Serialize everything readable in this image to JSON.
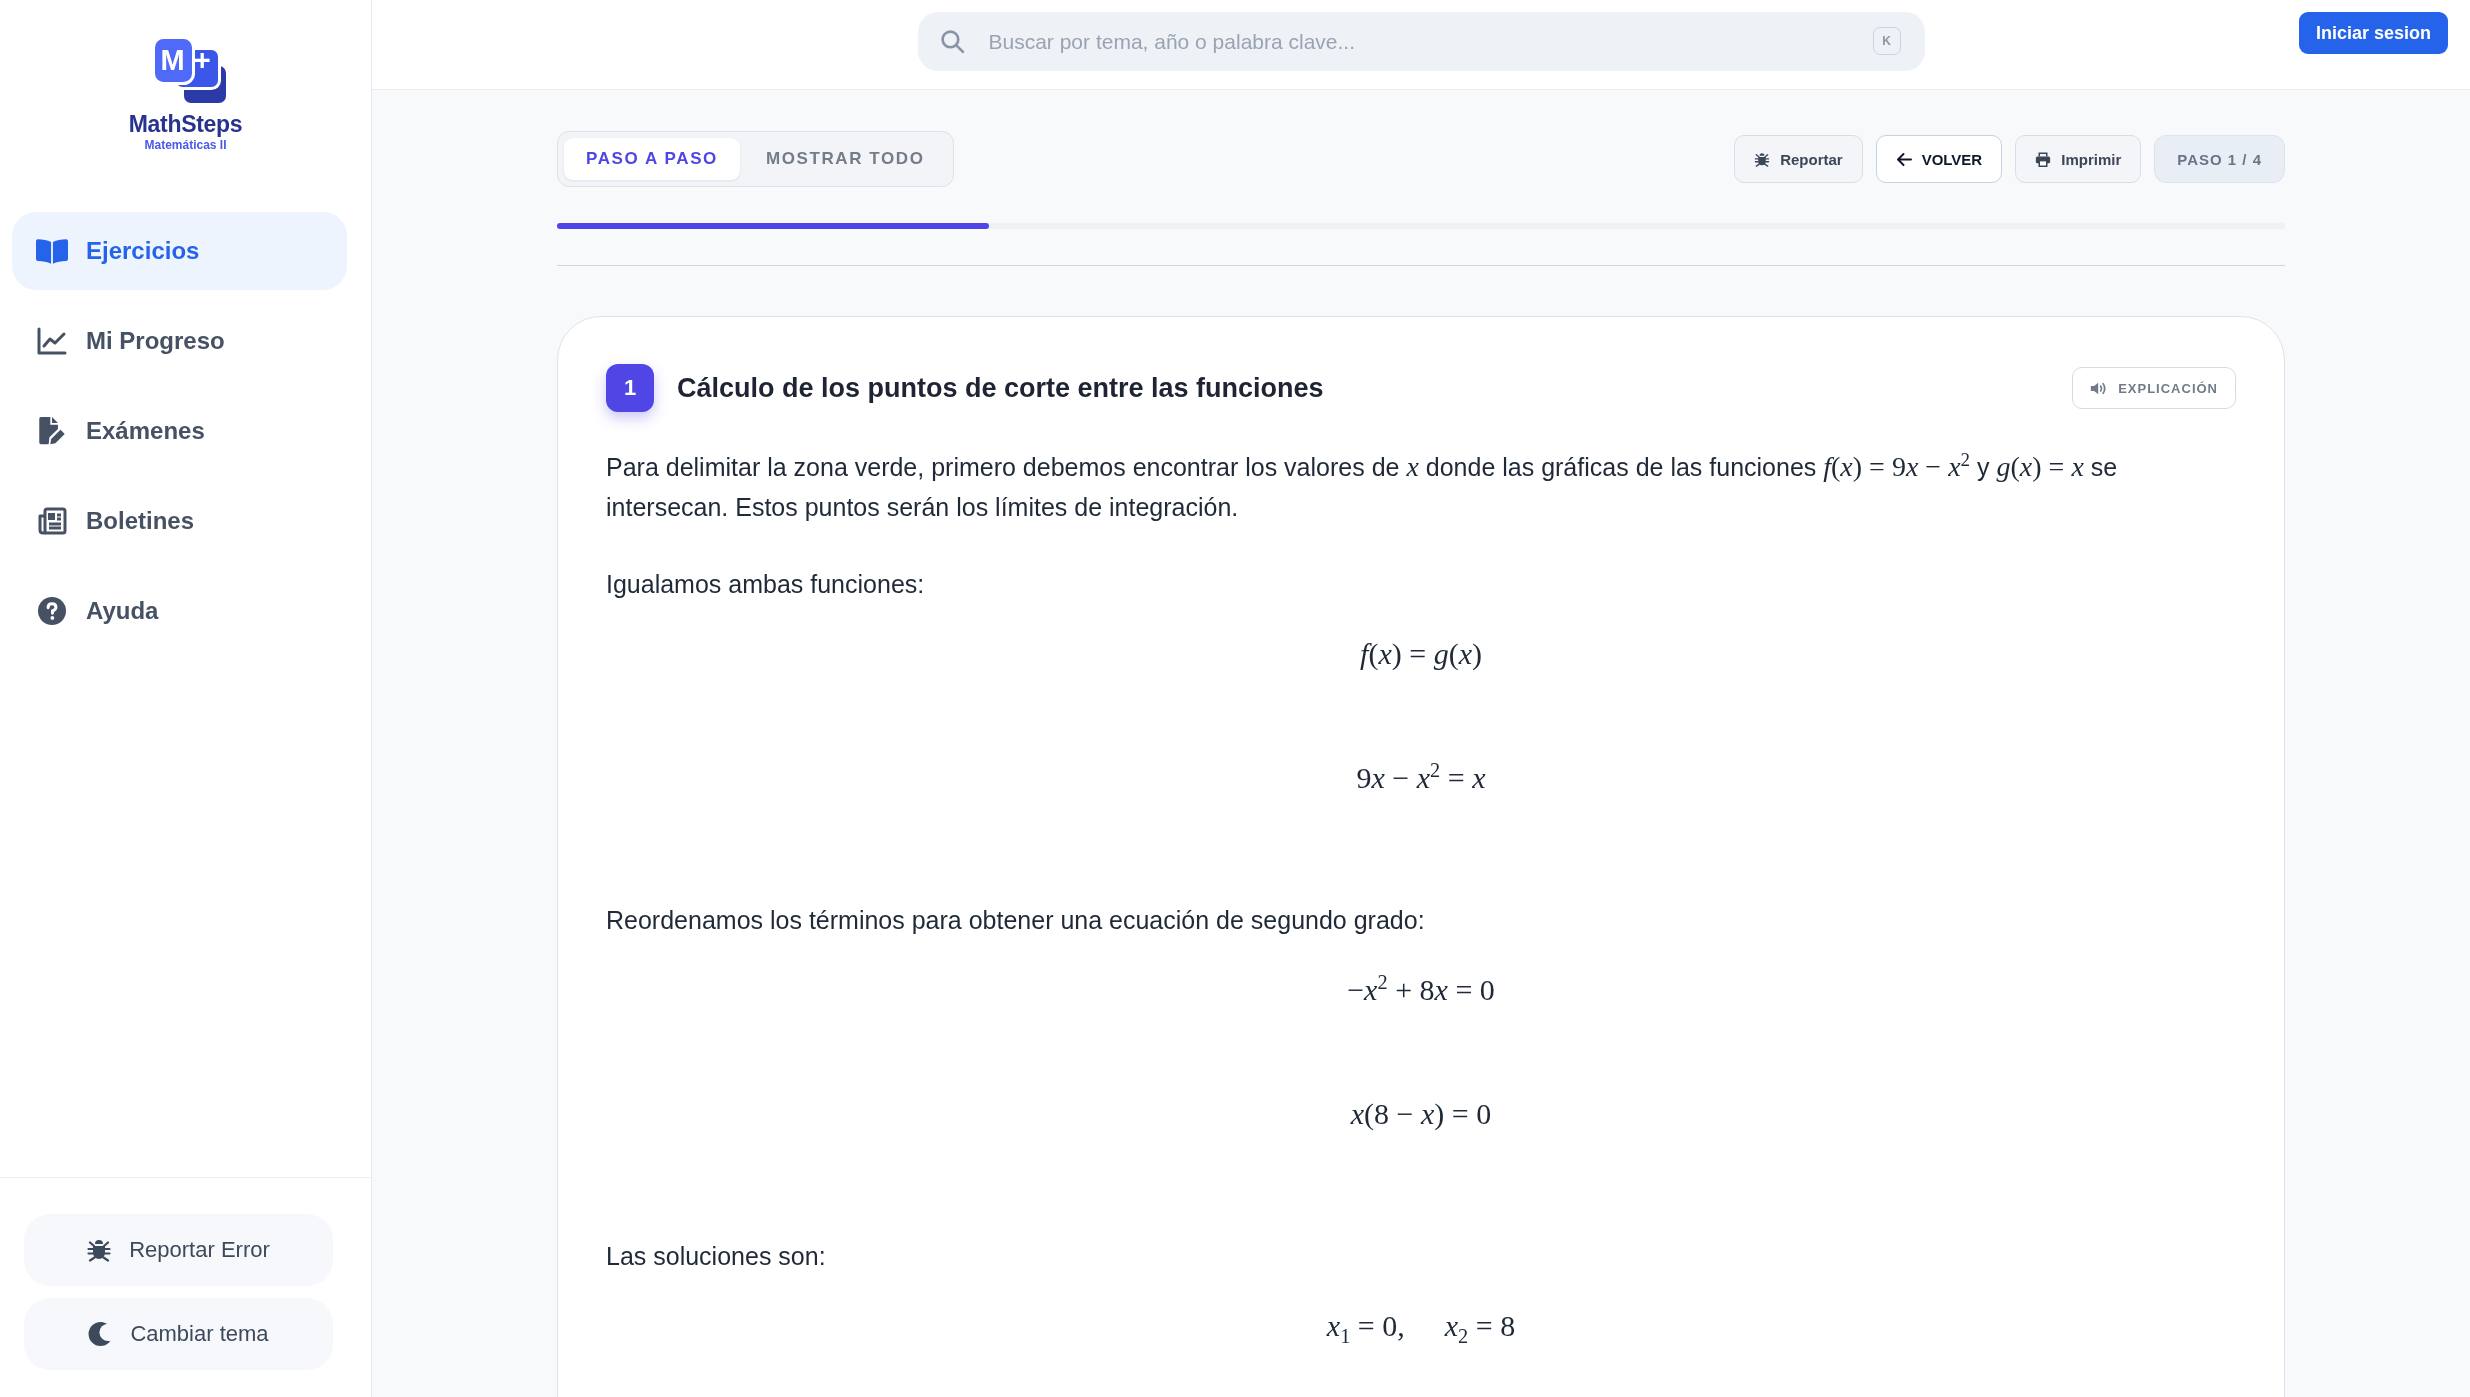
{
  "sidebar": {
    "logo": {
      "mark": "M+",
      "name": "MathSteps",
      "subtitle": "Matemáticas II"
    },
    "nav": [
      {
        "label": "Ejercicios",
        "selected": true
      },
      {
        "label": "Mi Progreso",
        "selected": false
      },
      {
        "label": "Exámenes",
        "selected": false
      },
      {
        "label": "Boletines",
        "selected": false
      },
      {
        "label": "Ayuda",
        "selected": false
      }
    ],
    "footer_buttons": [
      {
        "label": "Reportar Error"
      },
      {
        "label": "Cambiar tema"
      }
    ]
  },
  "header": {
    "search": {
      "placeholder": "Buscar por tema, año o palabra clave...",
      "shortcut": "K"
    },
    "login_button": "Iniciar sesion"
  },
  "toolbar": {
    "tabs": [
      {
        "label": "PASO A PASO",
        "selected": true
      },
      {
        "label": "MOSTRAR TODO",
        "selected": false
      }
    ],
    "buttons": [
      {
        "label": "Reportar",
        "kind": "soft"
      },
      {
        "label": "VOLVER",
        "kind": "outline"
      },
      {
        "label": "Imprimir",
        "kind": "soft"
      }
    ],
    "step_indicator": "PASO 1 / 4",
    "progress": {
      "level": 0.25
    }
  },
  "step": {
    "number": "1",
    "title": "Cálculo de los puntos de corte entre las funciones",
    "audio_button": "EXPLICACIÓN",
    "blocks": [
      {
        "kind": "paragraph",
        "segments": [
          {
            "kind": "text",
            "text": "Para delimitar la zona verde, primero debemos encontrar los valores de "
          },
          {
            "kind": "math",
            "text": "x"
          },
          {
            "kind": "text",
            "text": " donde las gráficas de las funciones "
          },
          {
            "kind": "math",
            "text": "f(x) = 9x − x$^{2}$"
          },
          {
            "kind": "text",
            "text": " y "
          },
          {
            "kind": "math",
            "text": "g(x) = x"
          },
          {
            "kind": "text",
            "text": " se intersecan. Estos puntos serán los límites de integración."
          }
        ]
      },
      {
        "kind": "text",
        "text": "Igualamos ambas funciones:"
      },
      {
        "kind": "equation",
        "parts": [
          "f(x) = g(x)"
        ]
      },
      {
        "kind": "equation",
        "parts": [
          "9x − x$^{2}$ = x"
        ]
      },
      {
        "kind": "text",
        "text": "Reordenamos los términos para obtener una ecuación de segundo grado:"
      },
      {
        "kind": "equation",
        "parts": [
          "−x$^{2}$ + 8x = 0"
        ]
      },
      {
        "kind": "equation",
        "parts": [
          "x(8 − x) = 0"
        ]
      },
      {
        "kind": "text",
        "text": "Las soluciones son:"
      },
      {
        "kind": "equation",
        "parts": [
          "x$_{1}$ = 0,",
          "x$_{2}$ = 8"
        ]
      }
    ]
  }
}
